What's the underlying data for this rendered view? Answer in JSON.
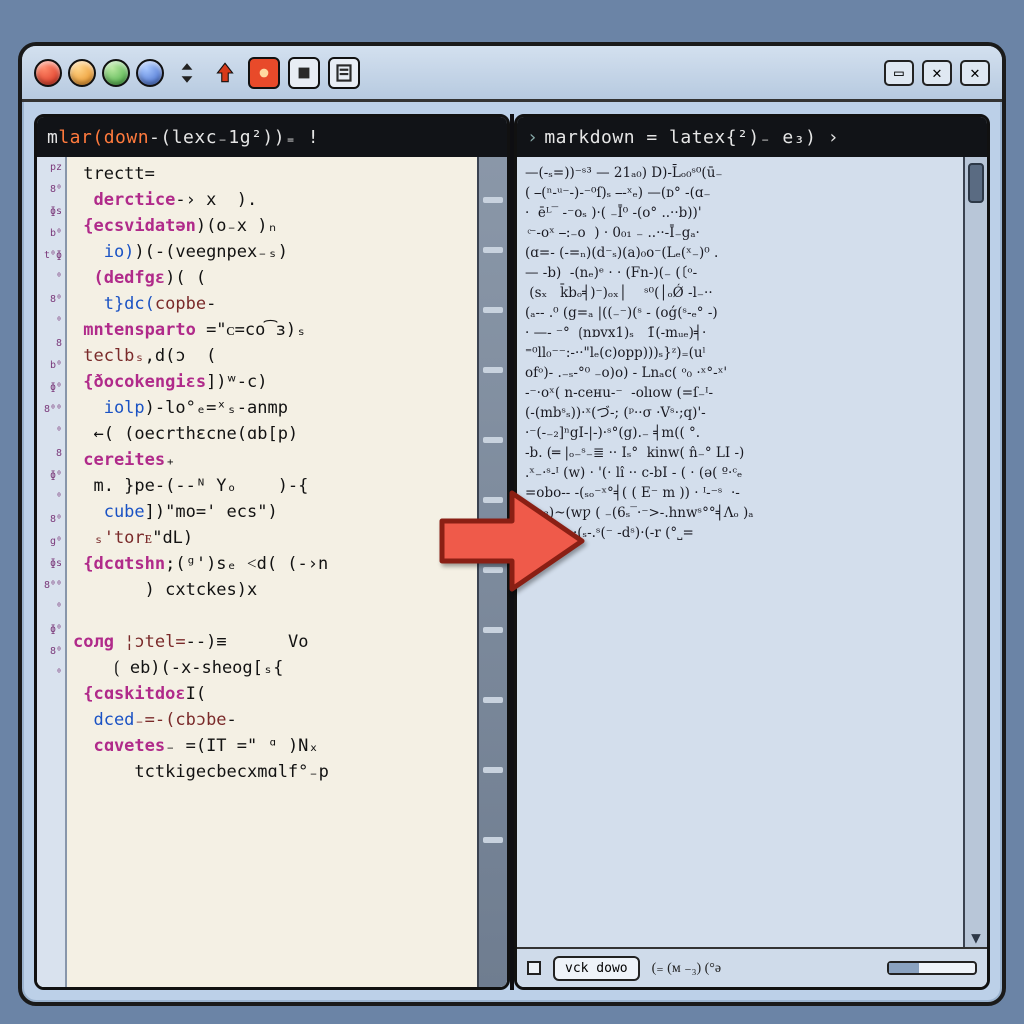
{
  "titlebar": {
    "lights": [
      "red",
      "or",
      "gr",
      "bl"
    ],
    "tool_icons": [
      "sort-icon",
      "up-arrow-icon",
      "record-icon",
      "stop-icon",
      "page-icon"
    ],
    "win_icons": [
      "minimize-icon",
      "close-icon",
      "close-icon-2"
    ]
  },
  "left": {
    "title_prefix": "m ",
    "title_accent": "lar(down",
    "title_rest": " -(lexc₋1g²))₌ !",
    "gutter": "pz\n8⁰\nɸs\nb⁰\nt⁰ɸ\n⁰\n8⁰\n⁰\n8\nb⁰\nɸ⁰\n8⁰⁰\n⁰\n8\nɸ⁰\n⁰\n8⁰\ng⁰\nɸs\n8⁰⁰\n⁰\nɸ⁰\n8⁰\n⁰",
    "code": {
      "lines": [
        {
          "plain": " trectt="
        },
        {
          "kw": "  dercticе",
          "plain": "-› x  )."
        },
        {
          "kw": " {ecsvidatən",
          "plain": ")(o₋x )ₙ"
        },
        {
          "fn": "   io)",
          "plain": ")(-(veegnpex₋ₛ)"
        },
        {
          "kw": "  (dedfgε",
          "plain": ")( ("
        },
        {
          "fn": "   t}dc(",
          "id": "coрbe",
          "plain": "-"
        },
        {
          "kw": " mntensparto",
          "plain": " =\"ᴄ=co͡з)ₛ"
        },
        {
          "id": " teclbₛ",
          "plain": ",d(ɔ  ("
        },
        {
          "kw": " {ðocokengiεs",
          "plain": "])ʷ-c)"
        },
        {
          "fn": "   iolр",
          "plain": ")-lo°ₑ=ˣₛ-anmp"
        },
        {
          "plain": "  ←( (oecrthεcne(ɑb[p)"
        },
        {
          "kw": " cereites",
          "plain": "₊"
        },
        {
          "plain": "  m. }pe-(--ᴺ Yₒ    )-{"
        },
        {
          "fn": "   cube",
          "plain": "])\"mo=' eсs\")"
        },
        {
          "id": "  ₛ'torᴇ",
          "plain": "\"dL)"
        },
        {
          "kw": " {dcɑtshn",
          "plain": ";(ᵍ')sₑ ˂d( (-›n"
        },
        {
          "plain": "       ) cxtckеs)x"
        },
        {
          "plain": ""
        },
        {
          "id": " ¦ɔtel=",
          "kw": "coлg",
          "plain": "--)≡      Vo"
        },
        {
          "plain": "    ⟮ eb)(-x-sheоg[ₛ{"
        },
        {
          "kw": " {cɑskitdoε",
          "plain": "Ι("
        },
        {
          "fn": "  dced",
          "id": "₋=-(cbɔbe",
          "plain": "-"
        },
        {
          "kw": "  cɑvetes",
          "plain": "₋ =(IТ =\" ᵅ )Nₓ"
        },
        {
          "plain": "      tctkigеcbеcxmɑlf°₋p"
        }
      ]
    },
    "minimap_blocks": [
      40,
      90,
      150,
      210,
      280,
      340,
      410,
      470,
      540,
      610,
      680
    ]
  },
  "right": {
    "title_chev": "› ",
    "title_main": "markdown = latex{²)₋ e₃) ›",
    "preview": "—(-ₛ=))⁻ˢ³ — 21ₐ₀) D)-L̄ₒ₀ˢ⁰(ū₋\n( ⎯(ⁿ-ᵘ⁻-)-⁻⁰ſ)ₛ ⎯-ˣₑ) —(ᴅ° -(ɑ₋\n·  ēᴸ‾ -⁻oₛ )·( ₋Ī⁰ -(o° ..··b))'\n ͨ⁻-oˣ ⎯:₋o  ) · 0₀₁ ₋ ..··-Ī₋gₐ·\n(ɑ=- (-=ₙ)(d⁻ₛ)(a)₀o⁻(Lₑ(ˣ₋)⁰ .\n— -b)  -(nₑ)ᵉ · · (Fn-)(₋ (〔ᵒ-\n (sₓ   k̄bₒ╡)⁻)ₒₓ│    ˢ⁰(│ₒǾ -l₋··\n(ₐ-- .⁰ (g=ₐ |((₋⁻)(ˢ - (oǵ(ˢ-ₑ° -)\n· —- ⁻°  ⟮nɒᴠx1)ₛ   1̄(-mᵤₑ)╡·\n⁼⁰ll₀⁻⁻:-··\"lₑ(c)oрp)))ₛ}ᶻ)₌(uˡ\nofᵒ)- .₋ₛ-°⁰ ₋o)o) - Lnₐc( ᵒ₀ ·ˣ°-ˣ'\n-⁻·oˣ( n-cенu-⁻  -olıow (=ſ₋ᴵ-\n(-(mbˢₛ))·ˣ(づ-; (ᵖ··σ ·Vˢ·;q)'-\n·⁻(-₋₂]ⁿgI-|-)·ˢ°(g).₋ ╡m(( °.\n-b. (═ |ₒ₋ˢ₋≣ ·· Iₛ°  kinw( n̂₋° LI -)\n.ˣ₋·ˢ-ᴵ (w) · '(· lı̂ ·· с-bI - ( · (ǝ( º·ᶜₑ\n=obo-- -(ₛₒ⁻ˣ°╡( ( E⁻ m )) · ᴵ-⁻ˢ  ·-\n(-n₃)~(wƿ ( ₋(6ₛ‾·⁻>-.hnwˢ°°╡Λₒ )ₐ\n( √-c̄-  -·(ₛ-.ˢ(⁻ -dˢ)·(-r (°˽=",
    "status": {
      "button": "vck dоwo",
      "readout": "(₌ (м ₋₃)  (°ə"
    }
  },
  "arrow": {
    "name": "convert-arrow"
  }
}
